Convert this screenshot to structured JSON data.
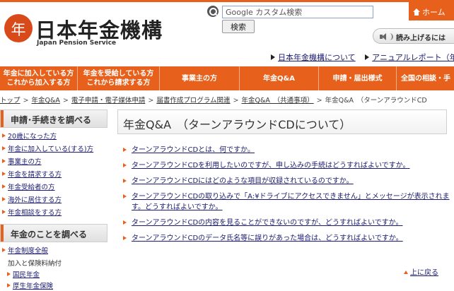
{
  "header": {
    "logo_mark": "年",
    "logo_title": "日本年金機構",
    "logo_subtitle": "Japan Pension Service",
    "search_placeholder": "Google カスタム検索",
    "search_button": "検索",
    "home_label": "ホーム",
    "read_aloud_label": "読み上げるには",
    "top_links": [
      "日本年金機構について",
      "アニュアルレポート（年"
    ]
  },
  "nav": {
    "items": [
      {
        "label": "年金に加入している方\nこれから加入する方"
      },
      {
        "label": "年金を受給している方\nこれから請求する方"
      },
      {
        "label": "事業主の方"
      },
      {
        "label": "年金Q&A"
      },
      {
        "label": "申請・届出様式"
      },
      {
        "label": "全国の相談・手"
      }
    ]
  },
  "breadcrumb": {
    "items": [
      "トップ",
      "年金Q&A",
      "電子申請・電子媒体申請",
      "届書作成プログラム関連",
      "年金Q&A　（共通事項）"
    ],
    "current": "年金Q&A　（ターンアラウンドCD"
  },
  "sidebar": {
    "section1_title": "申請･手続きを調べる",
    "section1_items": [
      "20歳になった方",
      "年金に加入している(する)方",
      "事業主の方",
      "年金を請求する方",
      "年金受給者の方",
      "海外に居住する方",
      "年金相談をする方"
    ],
    "section2_title": "年金のことを調べる",
    "section2_items": [
      "年金制度全般"
    ],
    "section2_plain": "加入と保険料納付",
    "section2_sub": [
      "国民年金",
      "厚生年金保険"
    ]
  },
  "main": {
    "title": "年金Q&A　（ターンアラウンドCDについて）",
    "questions": [
      "ターンアラウンドCDとは、何ですか。",
      "ターンアラウンドCDを利用したいのですが、申し込みの手続はどうすればよいですか。",
      "ターンアラウンドCDにはどのような項目が収録されているのですか。",
      "ターンアラウンドCDの取り込みで「A:¥ドライブにアクセスできません」とメッセージが表示されます。どうすればよいですか。",
      "ターンアラウンドCDの内容を見ることができないのですが、どうすればよいですか。",
      "ターンアラウンドCDのデータ氏名等に誤りがあった場合は、どうすればよいですか。"
    ],
    "back_to_top": "上に戻る"
  },
  "colors": {
    "accent": "#e8611c",
    "link": "#1a1a6e"
  }
}
